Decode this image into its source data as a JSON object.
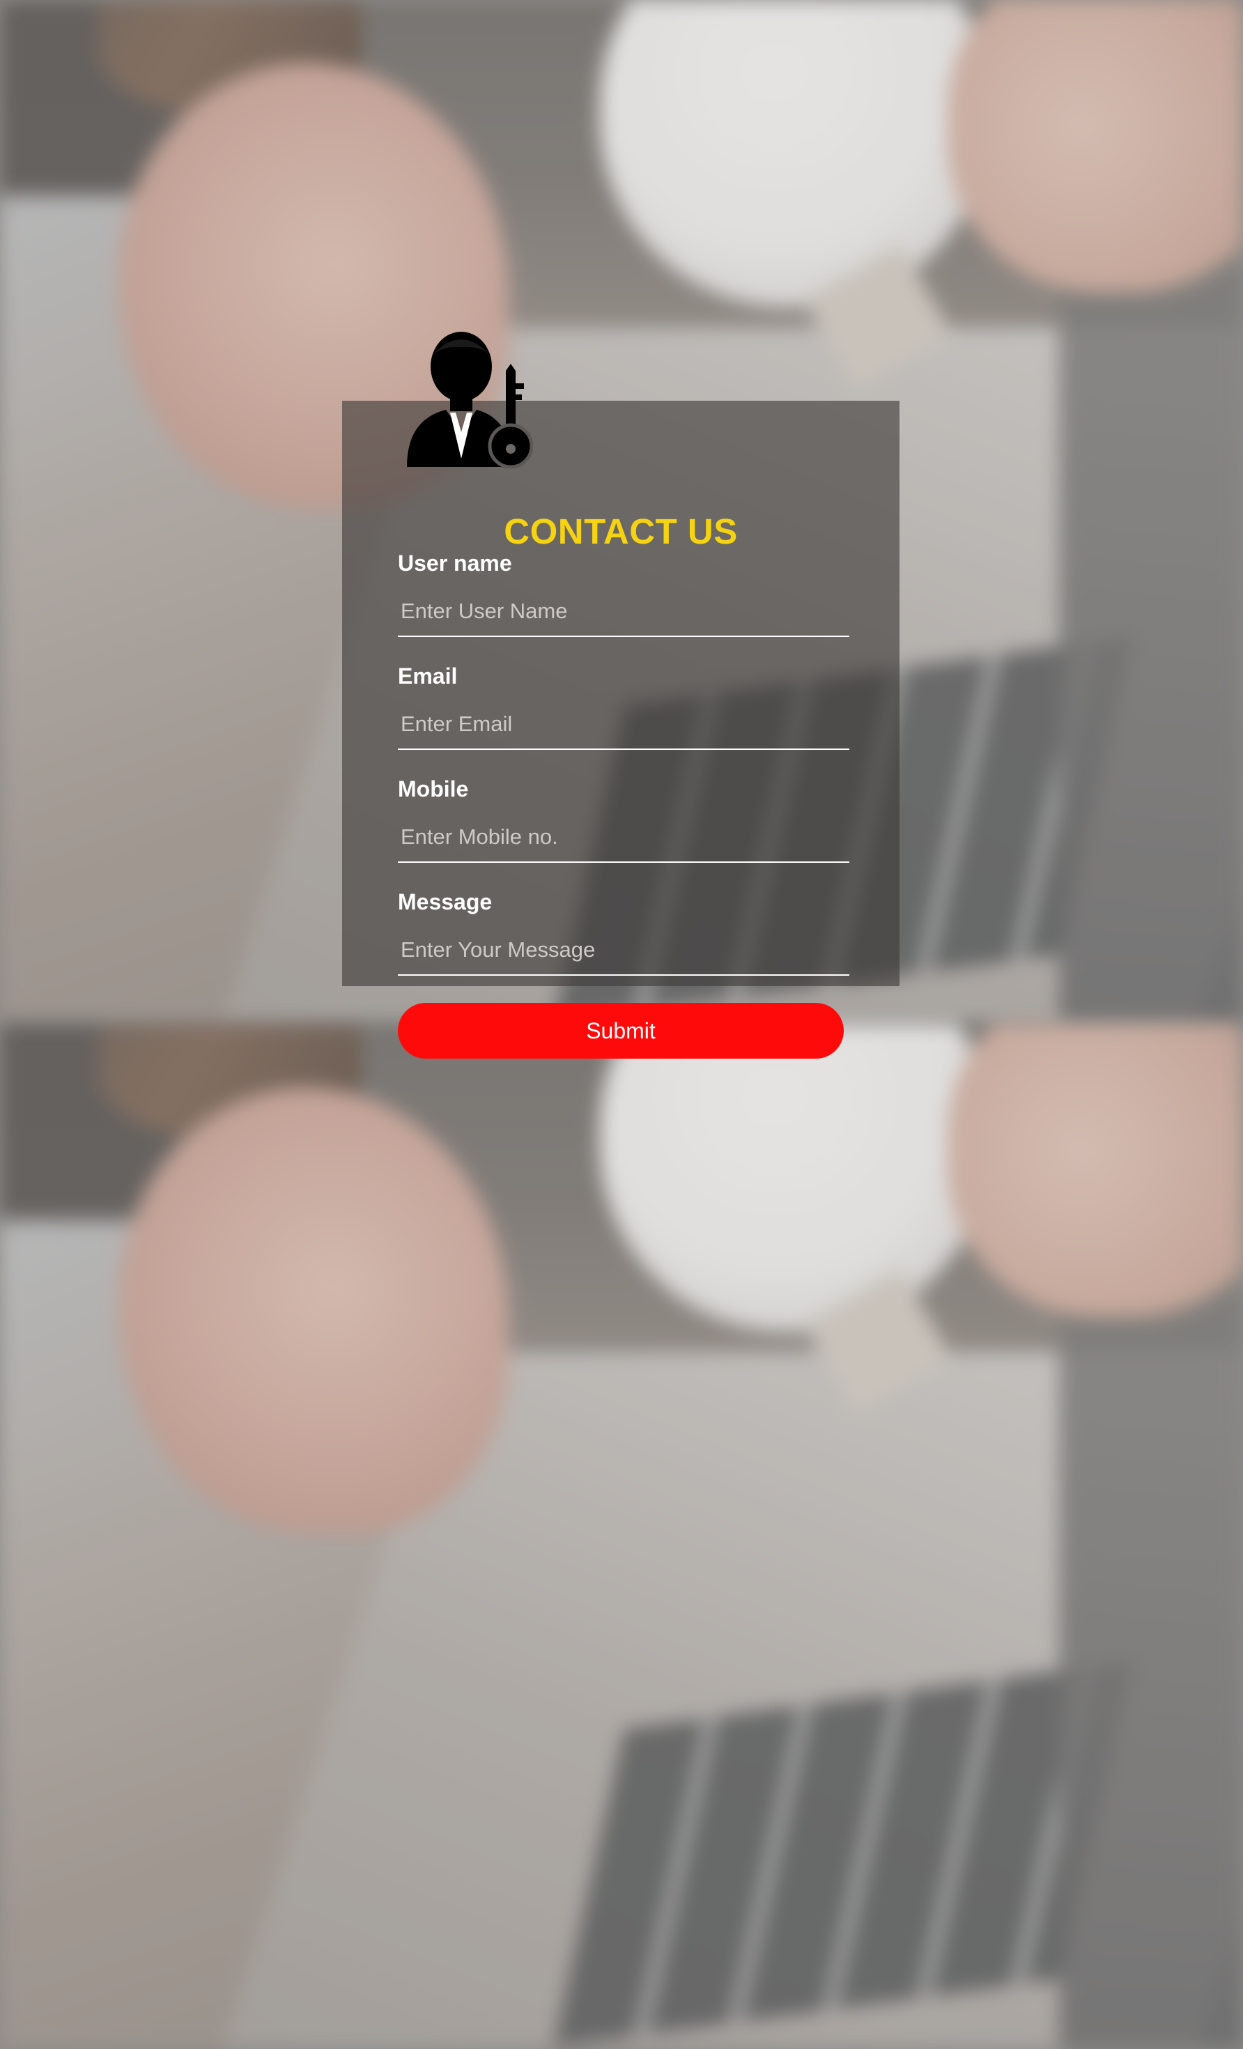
{
  "form": {
    "title": "CONTACT US",
    "fields": [
      {
        "label": "User name",
        "placeholder": "Enter User Name",
        "value": ""
      },
      {
        "label": "Email",
        "placeholder": "Enter Email",
        "value": ""
      },
      {
        "label": "Mobile",
        "placeholder": "Enter Mobile no.",
        "value": ""
      },
      {
        "label": "Message",
        "placeholder": "Enter Your Message",
        "value": ""
      }
    ],
    "submit_label": "Submit",
    "avatar_icon": "user-key-icon"
  },
  "colors": {
    "title": "#f5d312",
    "submit_bg": "#ff0a0a",
    "card_bg": "rgba(62, 58, 56, 0.62)",
    "label": "#ffffff"
  }
}
